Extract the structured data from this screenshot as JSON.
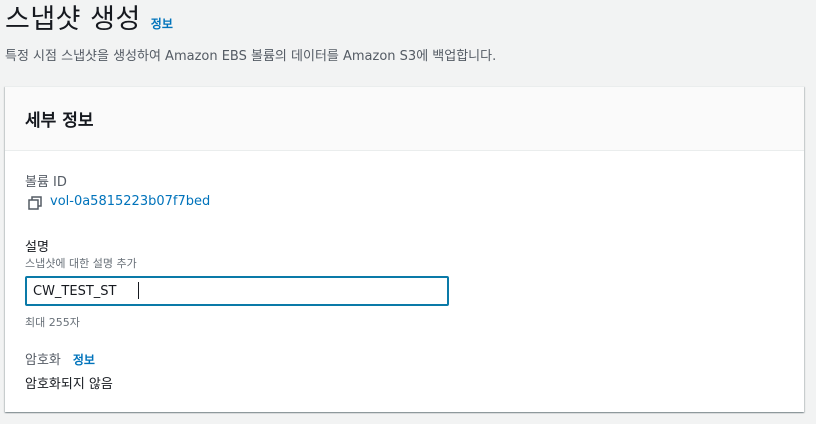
{
  "header": {
    "title": "스냅샷 생성",
    "info_label": "정보",
    "description": "특정 시점 스냅샷을 생성하여 Amazon EBS 볼륨의 데이터를 Amazon S3에 백업합니다."
  },
  "panel": {
    "title": "세부 정보",
    "volume": {
      "label": "볼륨 ID",
      "value": "vol-0a5815223b07f7bed",
      "copy_icon": "copy-icon"
    },
    "description_field": {
      "label": "설명",
      "hint": "스냅샷에 대한 설명 추가",
      "value": "CW_TEST_ST",
      "constraint": "최대 255자"
    },
    "encryption": {
      "label": "암호화",
      "info_label": "정보",
      "value": "암호화되지 않음"
    }
  },
  "colors": {
    "link": "#0073bb",
    "focus_border": "#0a7aa8",
    "background": "#f2f3f3"
  }
}
